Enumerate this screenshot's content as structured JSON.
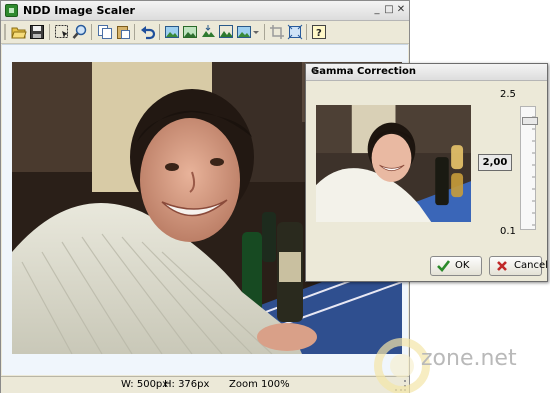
{
  "window": {
    "title": "NDD Image Scaler",
    "minimize": "_",
    "maximize": "□",
    "close": "✕"
  },
  "toolbar": {
    "buttons": [
      "open-icon",
      "save-icon",
      "select-icon",
      "zoom-icon",
      "copy-icon",
      "paste-icon",
      "undo-icon",
      "image-icon-1",
      "image-icon-2",
      "resize-icon",
      "image-icon-3",
      "image-menu-icon",
      "crop-icon",
      "fit-icon",
      "help-icon"
    ]
  },
  "status": {
    "width": "W: 500px",
    "height": "H: 376px",
    "zoom": "Zoom 100%"
  },
  "dialog": {
    "title": "Gamma Correction",
    "close": "✕",
    "scale_max": "2.5",
    "scale_min": "0.1",
    "gamma_value": "2,00",
    "ok_label": "OK",
    "cancel_label": "Cancel"
  },
  "watermark": {
    "text": "zone.net"
  },
  "colors": {
    "accent": "#3a7a2a",
    "titlebar": "#e6e6e6",
    "chrome": "#ece9d8"
  }
}
